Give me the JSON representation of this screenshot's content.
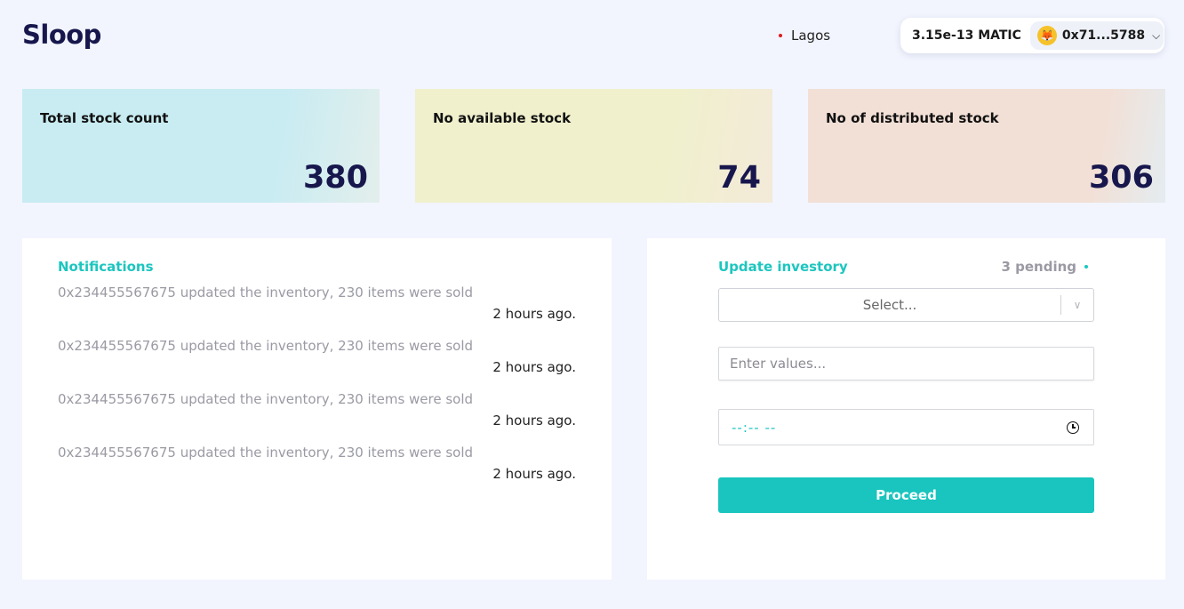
{
  "header": {
    "logo": "Sloop",
    "location": "Lagos",
    "wallet": {
      "balance": "3.15e-13 MATIC",
      "address": "0x71...5788",
      "avatar_icon": "fox-avatar-icon"
    }
  },
  "stats": [
    {
      "label": "Total stock count",
      "value": "380"
    },
    {
      "label": "No available stock",
      "value": "74"
    },
    {
      "label": "No of distributed stock",
      "value": "306"
    }
  ],
  "notifications": {
    "title": "Notifications",
    "items": [
      {
        "message": "0x234455567675 updated the inventory, 230 items were sold",
        "time": "2 hours ago."
      },
      {
        "message": "0x234455567675 updated the inventory, 230 items were sold",
        "time": "2 hours ago."
      },
      {
        "message": "0x234455567675 updated the inventory, 230 items were sold",
        "time": "2 hours ago."
      },
      {
        "message": "0x234455567675 updated the inventory, 230 items were sold",
        "time": "2 hours ago."
      }
    ]
  },
  "update": {
    "title": "Update investory",
    "pending": "3 pending",
    "select_placeholder": "Select...",
    "values_placeholder": "Enter values...",
    "time_value": "--:-- --",
    "proceed_label": "Proceed"
  },
  "colors": {
    "accent": "#19c5be",
    "brand": "#17174d",
    "location_dot": "#e0191d"
  }
}
